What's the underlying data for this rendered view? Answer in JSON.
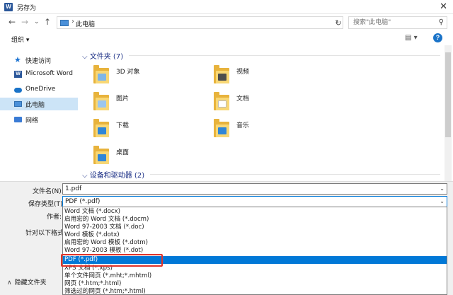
{
  "window": {
    "title": "另存为",
    "app_icon": "W",
    "close_glyph": "✕"
  },
  "nav": {
    "back": "←",
    "forward": "→",
    "down": "⌄",
    "up": "↑",
    "path_sep": "›",
    "location": "此电脑",
    "path_dd": "⌄",
    "refresh": "↻",
    "search_placeholder": "搜索\"此电脑\"",
    "search_glyph": "⚲"
  },
  "toolbar": {
    "organize": "组织 ▾",
    "view_glyph": "▤ ▾",
    "help": "?"
  },
  "sidebar": [
    {
      "label": "快速访问",
      "icon": "star-icon",
      "color": "#1e74d2"
    },
    {
      "label": "Microsoft Word",
      "icon": "word-icon",
      "color": "#2b579a"
    },
    {
      "label": "OneDrive",
      "icon": "cloud-icon",
      "color": "#1a73c8"
    },
    {
      "label": "此电脑",
      "icon": "computer-icon",
      "color": "#4a90d9",
      "selected": true
    },
    {
      "label": "网络",
      "icon": "network-icon",
      "color": "#3a7bd5"
    }
  ],
  "groups": {
    "folders_header": "⌵ 文件夹 (7)",
    "devices_header": "⌵ 设备和驱动器 (2)"
  },
  "folders": [
    {
      "label": "3D 对象",
      "badge": "#7fb6e8"
    },
    {
      "label": "视频",
      "badge": "#4d4d4d"
    },
    {
      "label": "图片",
      "badge": "#9bc6ee"
    },
    {
      "label": "文档",
      "badge": "#ffffff"
    },
    {
      "label": "下载",
      "badge": "#2f86d8"
    },
    {
      "label": "音乐",
      "badge": "#2f86d8"
    },
    {
      "label": "桌面",
      "badge": "#2f86d8"
    }
  ],
  "form": {
    "filename_label": "文件名(N):",
    "filename_value": "1.pdf",
    "filetype_label": "保存类型(T):",
    "filetype_value": "PDF (*.pdf)",
    "author_label": "作者:",
    "optimize_label": "针对以下格式优",
    "dropdown_glyph": "⌄",
    "hide_folders": "隐藏文件夹",
    "hide_glyph": "∧"
  },
  "filetype_options": [
    {
      "label": "Word 文档 (*.docx)"
    },
    {
      "label": "启用宏的 Word 文档 (*.docm)"
    },
    {
      "label": "Word 97-2003 文档 (*.doc)"
    },
    {
      "label": "Word 模板 (*.dotx)"
    },
    {
      "label": "启用宏的 Word 模板 (*.dotm)"
    },
    {
      "label": "Word 97-2003 模板 (*.dot)"
    },
    {
      "label": "PDF (*.pdf)",
      "selected": true
    },
    {
      "label": "XPS 文档 (*.xps)"
    },
    {
      "label": "单个文件网页 (*.mht;*.mhtml)"
    },
    {
      "label": "网页 (*.htm;*.html)"
    },
    {
      "label": "筛选过的网页 (*.htm;*.html)"
    }
  ],
  "colors": {
    "accent": "#0078d7",
    "highlight_box": "#e0332a",
    "sidebar_selected": "#cce4f7"
  }
}
